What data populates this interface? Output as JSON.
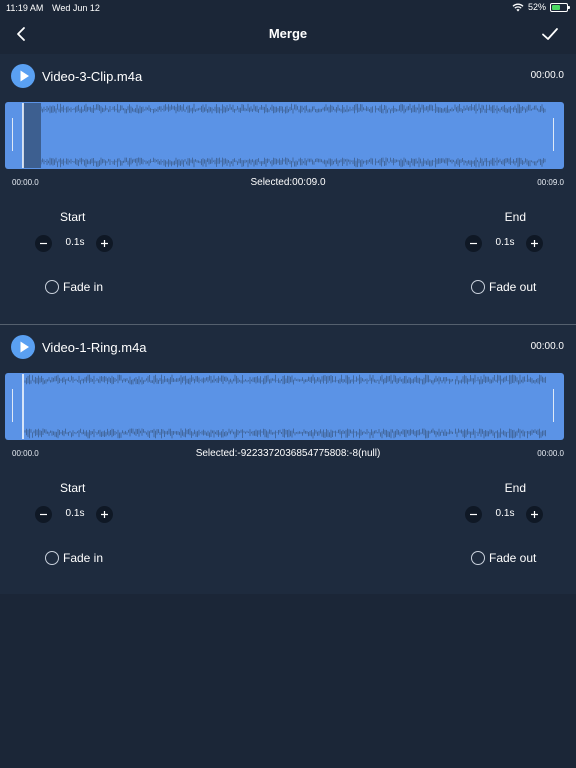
{
  "status": {
    "time": "11:19 AM",
    "date": "Wed Jun 12",
    "battery": "52%"
  },
  "nav": {
    "title": "Merge",
    "back_icon": "chevron-left-icon",
    "done_icon": "checkmark-icon"
  },
  "tracks": [
    {
      "name": "Video-3-Clip.m4a",
      "duration": "00:00.0",
      "start_time": "00:00.0",
      "end_time": "00:09.0",
      "selected": "Selected:00:09.0",
      "start_label": "Start",
      "start_value": "0.1s",
      "end_label": "End",
      "end_value": "0.1s",
      "fade_in": "Fade in",
      "fade_out": "Fade out"
    },
    {
      "name": "Video-1-Ring.m4a",
      "duration": "00:00.0",
      "start_time": "00:00.0",
      "end_time": "00:00.0",
      "selected": "Selected:-9223372036854775808:-8(null)",
      "start_label": "Start",
      "start_value": "0.1s",
      "end_label": "End",
      "end_value": "0.1s",
      "fade_in": "Fade in",
      "fade_out": "Fade out"
    }
  ],
  "colors": {
    "background": "#1b2637",
    "panel": "#1e2b3e",
    "accent": "#5aa0f2",
    "waveform": "#5b93e6",
    "wave_dark": "#3e5f8f"
  }
}
